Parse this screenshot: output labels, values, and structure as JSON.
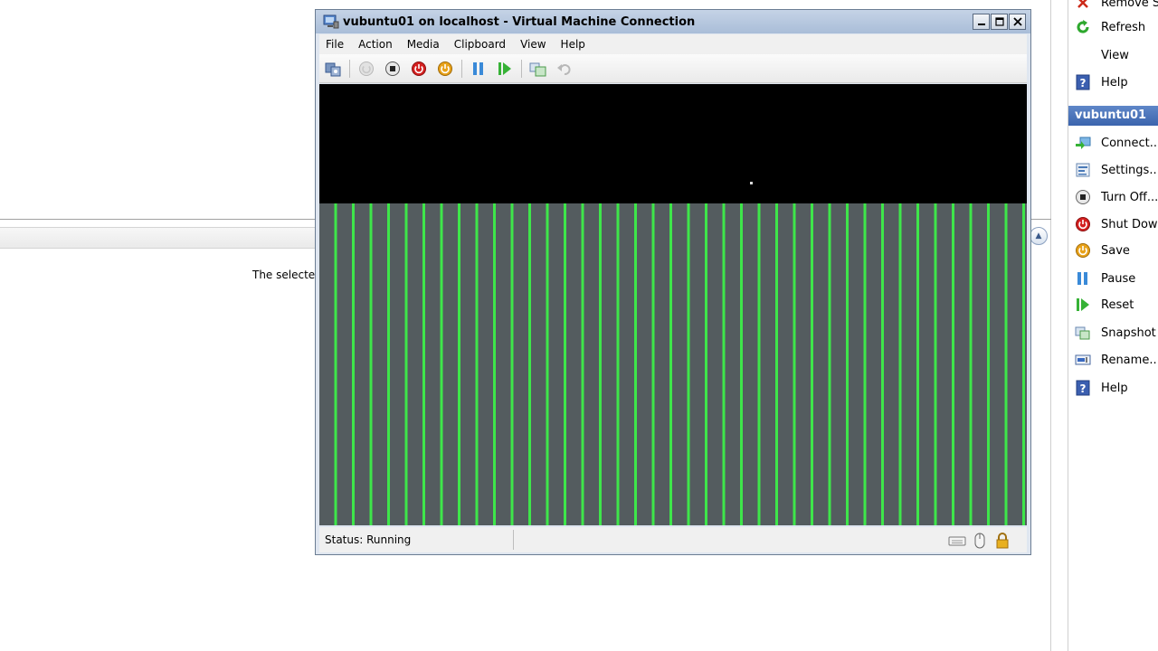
{
  "background": {
    "panel_text": "The selecte"
  },
  "actions_pane": {
    "top_items": [
      {
        "label": "Remove Se",
        "icon": "remove-icon"
      },
      {
        "label": "Refresh",
        "icon": "refresh-icon"
      },
      {
        "label": "View",
        "icon": ""
      },
      {
        "label": "Help",
        "icon": "help-icon"
      }
    ],
    "section_title": "vubuntu01",
    "vm_items": [
      {
        "label": "Connect...",
        "icon": "connect-icon"
      },
      {
        "label": "Settings...",
        "icon": "settings-icon"
      },
      {
        "label": "Turn Off...",
        "icon": "turn-off-icon"
      },
      {
        "label": "Shut Down...",
        "icon": "shut-down-icon"
      },
      {
        "label": "Save",
        "icon": "save-icon"
      },
      {
        "label": "Pause",
        "icon": "pause-icon"
      },
      {
        "label": "Reset",
        "icon": "reset-icon"
      },
      {
        "label": "Snapshot",
        "icon": "snapshot-icon"
      },
      {
        "label": "Rename...",
        "icon": "rename-icon"
      },
      {
        "label": "Help",
        "icon": "help-icon"
      }
    ]
  },
  "vm_window": {
    "title": "vubuntu01 on localhost - Virtual Machine Connection",
    "menu": [
      "File",
      "Action",
      "Media",
      "Clipboard",
      "View",
      "Help"
    ],
    "toolbar": [
      "ctrl-alt-del-icon",
      "start-icon",
      "turn-off-icon",
      "shut-down-icon",
      "save-icon",
      "pause-icon",
      "reset-icon",
      "snapshot-icon",
      "revert-icon"
    ],
    "status": "Status: Running",
    "colors": {
      "stripe_green": "#3ee64a",
      "stripe_gray": "#545c5f",
      "title_gradient_top": "#c5d3e6",
      "action_header": "#3b64ad"
    }
  }
}
